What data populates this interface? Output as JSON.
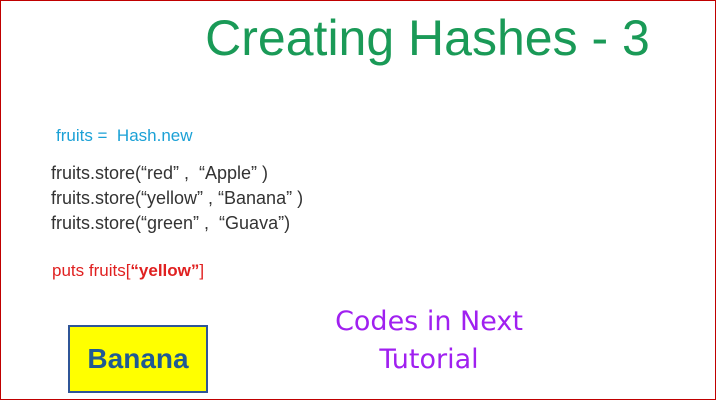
{
  "slide": {
    "title": "Creating Hashes - 3",
    "hash_new_line": "fruits =  Hash.new",
    "code_lines": [
      "fruits.store(“red” ,  “Apple” )",
      "fruits.store(“yellow” , “Banana” )",
      "fruits.store(“green” ,  “Guava”)"
    ],
    "puts": {
      "prefix": "puts fruits[",
      "key": "“yellow”",
      "suffix": "]"
    },
    "result": "Banana",
    "next_note": {
      "line1": "Codes in Next",
      "line2": "Tutorial"
    }
  },
  "colors": {
    "title": "#1a9a57",
    "hash_new": "#1ba1d6",
    "code": "#333333",
    "puts": "#e02020",
    "result_bg": "#ffff00",
    "result_border": "#2f5597",
    "result_text": "#1f5a93",
    "note": "#a020f0",
    "frame_border": "#c00000"
  }
}
